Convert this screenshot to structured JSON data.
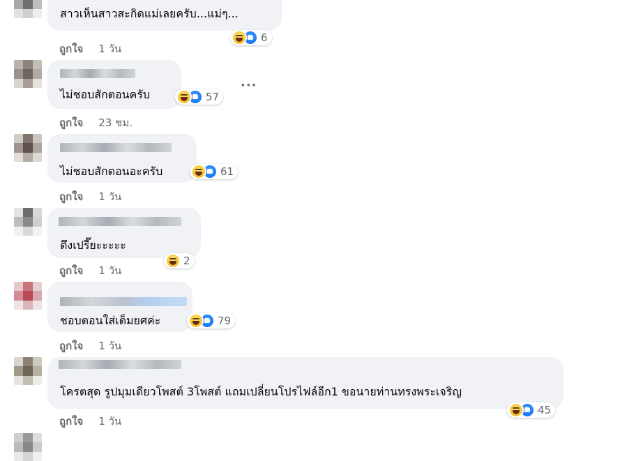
{
  "comments": [
    {
      "text": "สาวเห็นสาวสะกิดแม่เลยครับ...แม่ๆ...",
      "reactions": {
        "icons": [
          "haha-icon",
          "like-icon"
        ],
        "count": "6"
      },
      "like_label": "ถูกใจ",
      "time": "1 วัน"
    },
    {
      "text": "ไม่ชอบสักตอนครับ",
      "reactions": {
        "icons": [
          "haha-icon",
          "like-icon"
        ],
        "count": "57"
      },
      "like_label": "ถูกใจ",
      "time": "23 ชม.",
      "more": "···"
    },
    {
      "text": "ไม่ชอบสักตอนอะครับ",
      "reactions": {
        "icons": [
          "haha-icon",
          "like-icon"
        ],
        "count": "61"
      },
      "like_label": "ถูกใจ",
      "time": "1 วัน"
    },
    {
      "text": "ตึงเปรี๊ยะะะะะ",
      "reactions": {
        "icons": [
          "haha-icon"
        ],
        "count": "2"
      },
      "like_label": "ถูกใจ",
      "time": "1 วัน"
    },
    {
      "text": "ชอบตอนใส่เต็มยศค่ะ",
      "reactions": {
        "icons": [
          "haha-icon",
          "like-icon"
        ],
        "count": "79"
      },
      "like_label": "ถูกใจ",
      "time": "1 วัน"
    },
    {
      "text": "โครตสุด รูปมุมเดียวโพสต์ 3โพสต์ แถมเปลี่ยนโปรไฟล์อีก1 ขอนายท่านทรงพระเจริญ",
      "reactions": {
        "icons": [
          "haha-icon",
          "like-icon"
        ],
        "count": "45"
      },
      "like_label": "ถูกใจ",
      "time": "1 วัน"
    }
  ]
}
